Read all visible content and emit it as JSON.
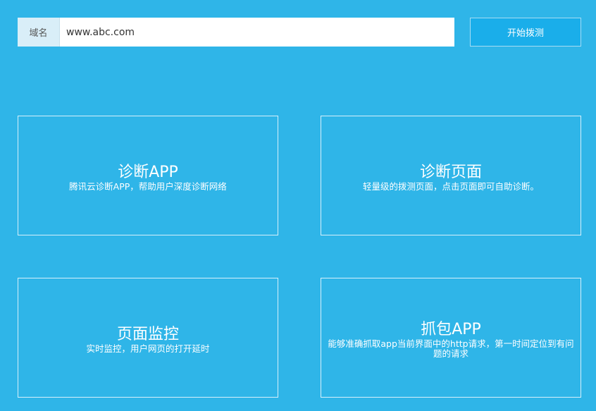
{
  "search": {
    "label": "域名",
    "value": "www.abc.com",
    "button_label": "开始拨测"
  },
  "cards": [
    {
      "title": "诊断APP",
      "description": "腾讯云诊断APP，帮助用户深度诊断网络"
    },
    {
      "title": "诊断页面",
      "description": "轻量级的拨测页面，点击页面即可自助诊断。"
    },
    {
      "title": "页面监控",
      "description": "实时监控，用户网页的打开延时"
    },
    {
      "title": "抓包APP",
      "description": "能够准确抓取app当前界面中的http请求，第一时间定位到有问题的请求"
    }
  ],
  "colors": {
    "background": "#2fb5e8",
    "button": "#1aaeea",
    "label_bg": "#d9eef8"
  }
}
